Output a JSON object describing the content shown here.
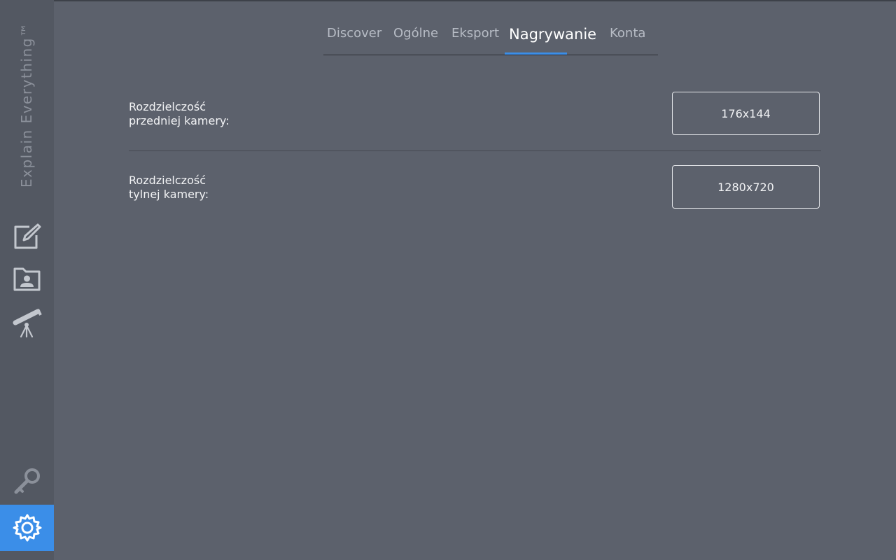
{
  "app": {
    "brand": "Explain Everything™"
  },
  "sidebar": {
    "icons": [
      "edit-icon",
      "folder-user-icon",
      "telescope-icon",
      "key-icon",
      "settings-gear-icon"
    ],
    "active": "settings-gear-icon"
  },
  "tabs": [
    {
      "label": "Discover"
    },
    {
      "label": "Ogólne"
    },
    {
      "label": "Eksport"
    },
    {
      "label": "Nagrywanie"
    },
    {
      "label": "Konta"
    }
  ],
  "active_tab": "Nagrywanie",
  "settings": {
    "front_camera": {
      "label_line1": "Rozdzielczość",
      "label_line2": "przedniej kamery:",
      "value": "176x144"
    },
    "rear_camera": {
      "label_line1": "Rozdzielczość",
      "label_line2": "tylnej kamery:",
      "value": "1280x720"
    }
  },
  "colors": {
    "background": "#5c616c",
    "sidebar": "#535862",
    "accent": "#3b8ee8"
  }
}
